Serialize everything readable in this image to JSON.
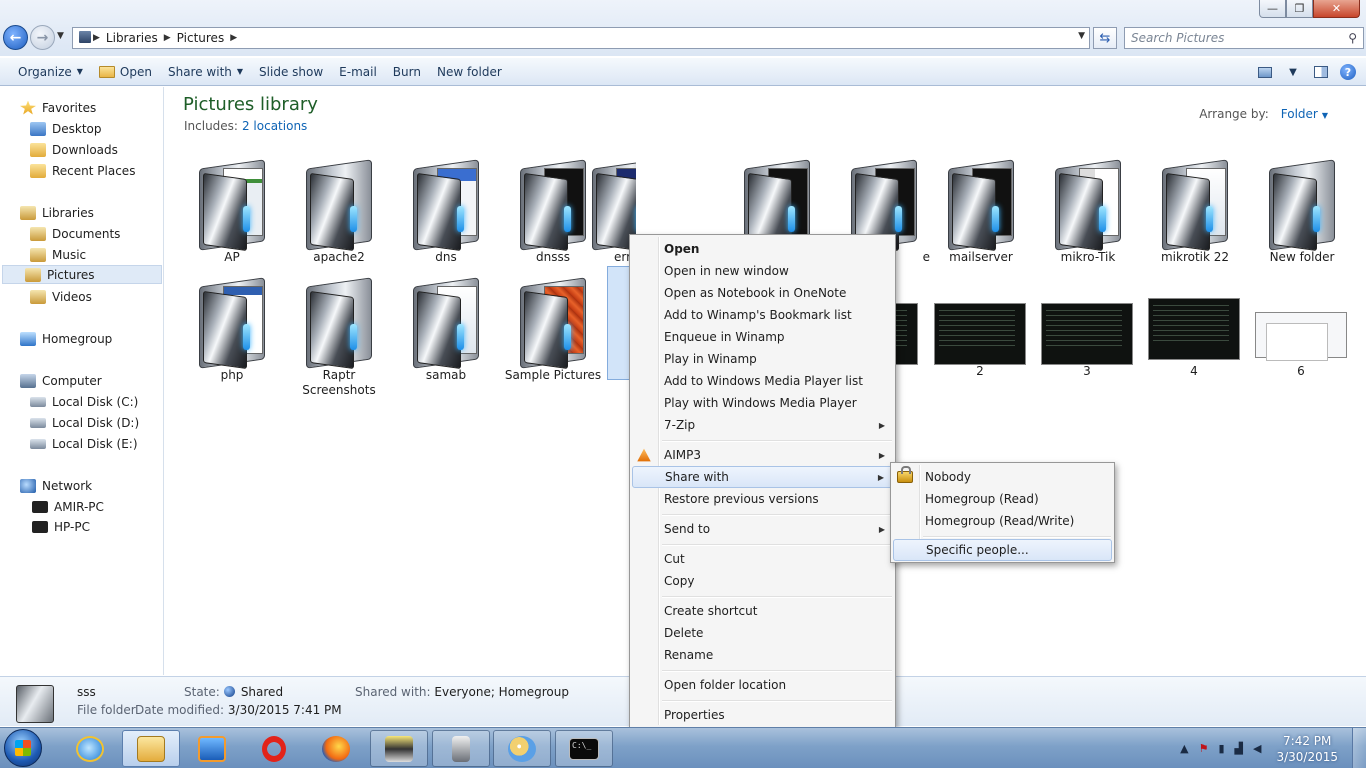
{
  "window": {
    "minimize": "—",
    "maximize": "❐",
    "close": "✕"
  },
  "address": {
    "crumbs": [
      "Libraries",
      "Pictures"
    ],
    "search_placeholder": "Search Pictures"
  },
  "toolbar": {
    "organize": "Organize",
    "open": "Open",
    "share_with": "Share with",
    "slide_show": "Slide show",
    "email": "E-mail",
    "burn": "Burn",
    "new_folder": "New folder"
  },
  "nav": {
    "favorites": "Favorites",
    "desktop": "Desktop",
    "downloads": "Downloads",
    "recent": "Recent Places",
    "libraries": "Libraries",
    "documents": "Documents",
    "music": "Music",
    "pictures": "Pictures",
    "videos": "Videos",
    "homegroup": "Homegroup",
    "computer": "Computer",
    "disk_c": "Local Disk (C:)",
    "disk_d": "Local Disk (D:)",
    "disk_e": "Local Disk (E:)",
    "network": "Network",
    "pc1": "AMIR-PC",
    "pc2": "HP-PC"
  },
  "library": {
    "title": "Pictures library",
    "includes_label": "Includes:",
    "locations": "2 locations",
    "arrange_label": "Arrange by:",
    "arrange_value": "Folder"
  },
  "folders_row1": [
    "AP",
    "apache2",
    "dns",
    "dnsss",
    "err",
    "",
    "e",
    "mailserver",
    "mikro-Tik",
    "mikrotik 22",
    "New folder"
  ],
  "folders_row2": [
    "php",
    "Raptr Screenshots",
    "samab",
    "Sample Pictures"
  ],
  "images": [
    "2",
    "3",
    "4",
    "6"
  ],
  "details": {
    "name": "sss",
    "type": "File folder",
    "state_label": "State:",
    "state_value": "Shared",
    "shared_label": "Shared with:",
    "shared_value": "Everyone; Homegroup",
    "modified_label": "Date modified:",
    "modified_value": "3/30/2015 7:41 PM"
  },
  "context_menu": {
    "open": "Open",
    "open_new_window": "Open in new window",
    "onenote": "Open as Notebook in OneNote",
    "winamp_bookmark": "Add to Winamp's Bookmark list",
    "winamp_enqueue": "Enqueue in Winamp",
    "winamp_play": "Play in Winamp",
    "wmp_add": "Add to Windows Media Player list",
    "wmp_play": "Play with Windows Media Player",
    "zip": "7-Zip",
    "aimp": "AIMP3",
    "share_with": "Share with",
    "restore": "Restore previous versions",
    "send_to": "Send to",
    "cut": "Cut",
    "copy": "Copy",
    "create_shortcut": "Create shortcut",
    "delete": "Delete",
    "rename": "Rename",
    "open_location": "Open folder location",
    "properties": "Properties"
  },
  "share_submenu": {
    "nobody": "Nobody",
    "hg_read": "Homegroup (Read)",
    "hg_rw": "Homegroup (Read/Write)",
    "specific": "Specific people..."
  },
  "taskbar": {
    "cmd_text": "C:\\_",
    "time": "7:42 PM",
    "date": "3/30/2015"
  }
}
